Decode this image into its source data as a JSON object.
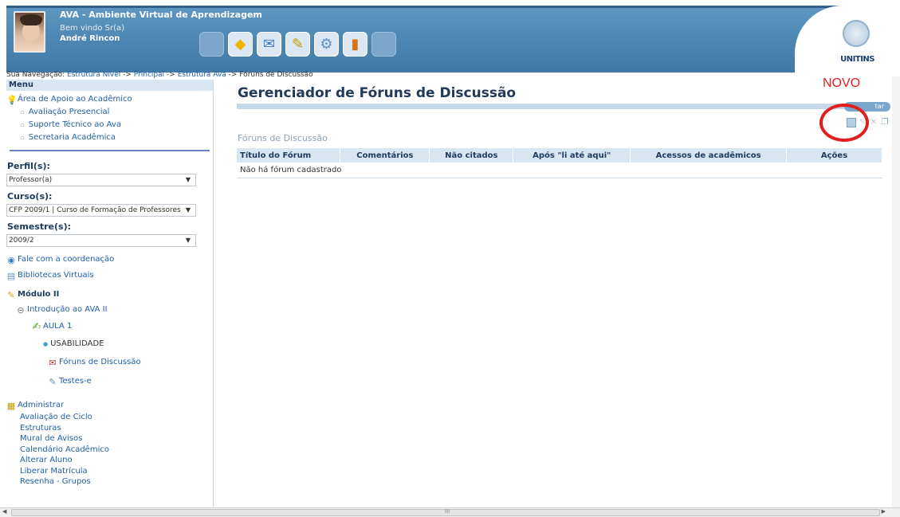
{
  "header": {
    "app_title": "AVA - Ambiente Virtual de Aprendizagem",
    "welcome": "Bem vindo Sr(a)",
    "username": "André Rincon",
    "logo_text": "UNITINS",
    "toolbar_icons": [
      "blank",
      "diamond-icon",
      "mail-icon",
      "tools-icon",
      "gear-icon",
      "book-icon",
      "blank"
    ]
  },
  "breadcrumb": {
    "prefix": "Sua Navegação:",
    "items": [
      "Estrutura Nível",
      "Principal",
      "Estrutura Ava",
      "Fóruns de Discussão"
    ],
    "separator": "->"
  },
  "sidebar": {
    "menu_title": "Menu",
    "support": {
      "title": "Área de Apoio ao Acadêmico",
      "items": [
        "Avaliação Presencial",
        "Suporte Técnico ao Ava",
        "Secretaria Acadêmica"
      ]
    },
    "perfil": {
      "label": "Perfil(s):",
      "value": "Professor(a)"
    },
    "curso": {
      "label": "Curso(s):",
      "value": "CFP 2009/1 | Curso de Formação de Professores"
    },
    "semestre": {
      "label": "Semestre(s):",
      "value": "2009/2"
    },
    "links": [
      "Fale com a coordenação",
      "Bibliotecas Virtuais"
    ],
    "modulo": {
      "title": "Módulo II",
      "intro": "Introdução ao AVA II",
      "aula": "AULA 1",
      "items": [
        "USABILIDADE",
        "Fóruns de Discussão",
        "Testes-e"
      ]
    },
    "admin": {
      "title": "Administrar",
      "items": [
        "Avaliação de Ciclo",
        "Estruturas",
        "Mural de Avisos",
        "Calendário Acadêmico",
        "Alterar Aluno",
        "Liberar Matrícula",
        "Resenha - Grupos"
      ]
    }
  },
  "main": {
    "title": "Gerenciador de Fóruns de Discussão",
    "annotation": "NOVO",
    "bar_button_fragment": "tar",
    "section_title": "Fóruns de Discussão",
    "columns": [
      "Título do Fórum",
      "Comentários",
      "Não citados",
      "Após \"li até aqui\"",
      "Acessos de acadêmicos",
      "Ações"
    ],
    "empty_message": "Não há fórum cadastrado"
  },
  "scrollbar": {
    "grip": "III"
  },
  "colors": {
    "header": "#4f89b6",
    "accent": "#1f5fa8",
    "annotation": "#e21f1f"
  }
}
